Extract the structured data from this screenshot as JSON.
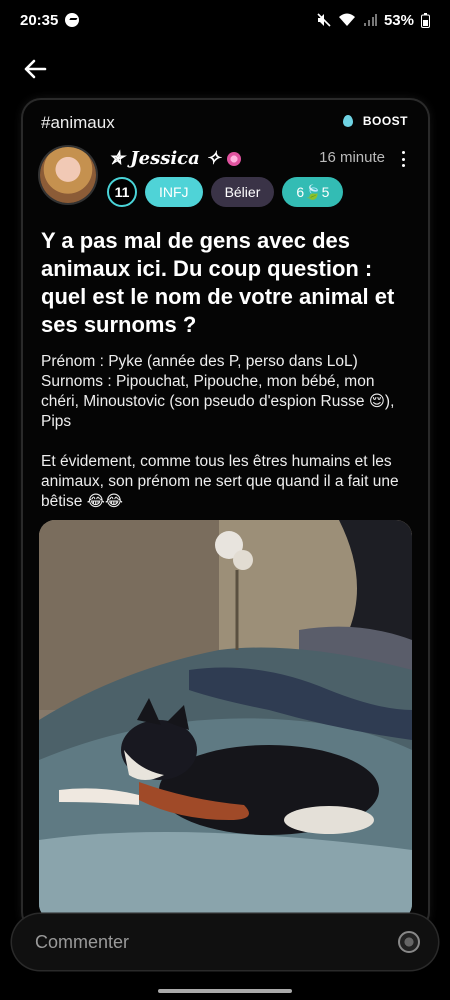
{
  "status_bar": {
    "time": "20:35",
    "battery": "53%"
  },
  "post": {
    "tag": "#animaux",
    "boost_label": "BOOST",
    "author": {
      "name": "Jessica",
      "decoration_left": "✯",
      "decoration_right": "✧"
    },
    "time": "16 minute",
    "badges": {
      "level": "11",
      "type": "INFJ",
      "sign": "Bélier",
      "count": "6🍃5"
    },
    "title": "Y a pas mal de gens avec des animaux ici. Du coup question : quel est le nom de votre animal et ses surnoms ?",
    "body": "Prénom : Pyke (année des P, perso dans LoL)\nSurnoms : Pipouchat, Pipouche, mon bébé, mon chéri, Minoustovic (son pseudo d'espion Russe 😌), Pips\n\nEt évidement, comme tous les êtres humains et les animaux, son prénom ne sert que quand il a fait une bêtise  😂😂"
  },
  "comment": {
    "placeholder": "Commenter"
  },
  "icons": {
    "back": "arrow-left-icon",
    "more": "more-vertical-icon",
    "boost": "water-drop-icon",
    "emoji": "sticker-icon"
  },
  "colors": {
    "accent": "#4fd3d7",
    "card_bg": "#050505"
  }
}
